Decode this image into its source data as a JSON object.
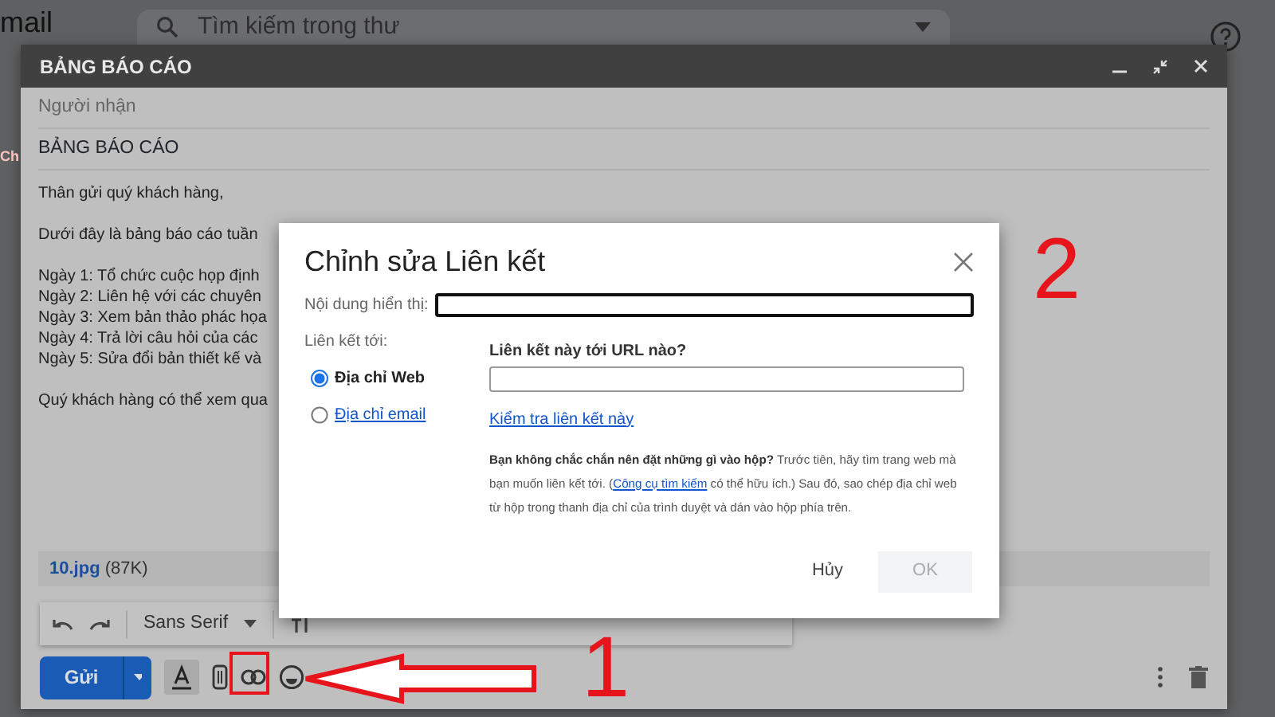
{
  "app": {
    "logo_text": "mail",
    "search_placeholder": "Tìm kiếm trong thư",
    "side_tab": "Ch"
  },
  "compose": {
    "title": "BẢNG BÁO CÁO",
    "recipients_placeholder": "Người nhận",
    "subject": "BẢNG BÁO CÁO",
    "paragraphs": [
      [
        "Thân gửi quý khách hàng,"
      ],
      [
        "Dưới đây là bảng báo cáo tuần"
      ],
      [
        "Ngày 1: Tổ chức cuộc họp định",
        "Ngày 2: Liên hệ với các chuyên",
        "Ngày 3: Xem bản thảo phác họa",
        "Ngày 4: Trả lời câu hỏi của các",
        "Ngày 5: Sửa đổi bản thiết kế và"
      ],
      [
        "Quý khách hàng có thể xem qua"
      ]
    ],
    "attachment": {
      "name": "10.jpg",
      "size": "(87K)"
    },
    "font": "Sans Serif",
    "send": "Gửi"
  },
  "dialog": {
    "title": "Chỉnh sửa Liên kết",
    "display_text_label": "Nội dung hiển thị:",
    "link_to_label": "Liên kết tới:",
    "options": [
      {
        "label": "Địa chỉ Web",
        "selected": true
      },
      {
        "label": "Địa chỉ email",
        "selected": false
      }
    ],
    "url_label": "Liên kết này tới URL nào?",
    "test_link": "Kiểm tra liên kết này",
    "help": {
      "bold": "Bạn không chắc chắn nên đặt những gì vào hộp?",
      "before": " Trước tiên, hãy tìm trang web mà bạn muốn liên kết tới. (",
      "link": "Công cụ tìm kiếm",
      "after": " có thể hữu ích.) Sau đó, sao chép địa chỉ web từ hộp trong thanh địa chỉ của trình duyệt và dán vào hộp phía trên."
    },
    "buttons": [
      {
        "label": "Hủy",
        "disabled": false
      },
      {
        "label": "OK",
        "disabled": true
      }
    ]
  },
  "annotations": [
    {
      "label": "1"
    },
    {
      "label": "2"
    }
  ]
}
